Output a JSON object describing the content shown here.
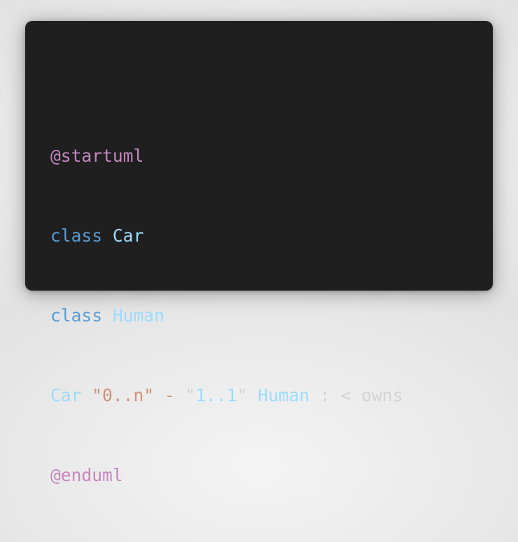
{
  "code": {
    "line1": {
      "directive": "@startuml"
    },
    "line2": {
      "keyword": "class",
      "name": "Car"
    },
    "line3": {
      "keyword": "class",
      "name": "Human"
    },
    "line4": {
      "left": "Car",
      "left_mult": "\"0..n\"",
      "dash": "-",
      "right_mult_q1": "\"",
      "right_mult_val": "1..1",
      "right_mult_q2": "\"",
      "right": "Human",
      "colon": ":",
      "arrow": "<",
      "label": "owns"
    },
    "line5": {
      "directive": "@enduml"
    }
  },
  "colors": {
    "background": "#1f1f1f",
    "directive": "#c586c0",
    "keyword": "#569cd6",
    "identifier": "#9cdcfe",
    "string": "#ce9178",
    "text": "#d4d4d4"
  }
}
